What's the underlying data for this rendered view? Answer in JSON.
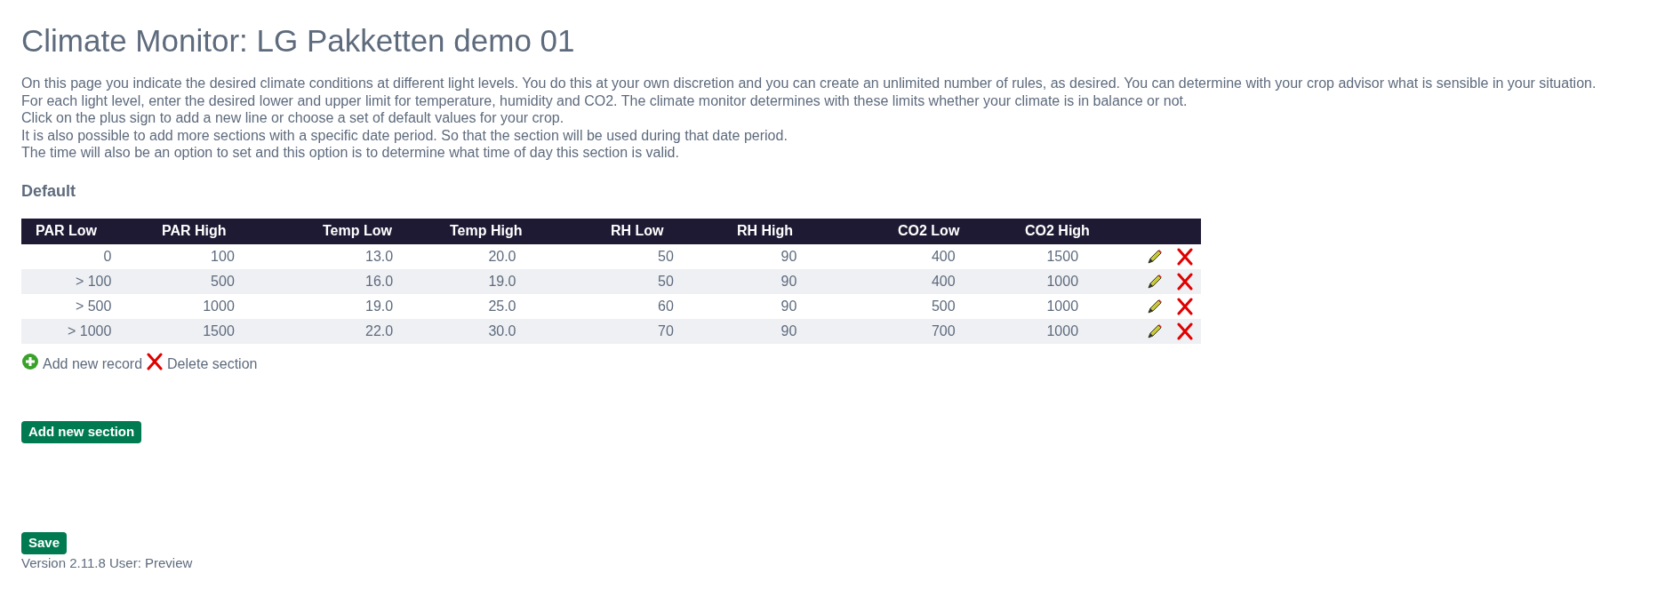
{
  "title": "Climate Monitor: LG Pakketten demo 01",
  "intro": [
    "On this page you indicate the desired climate conditions at different light levels. You do this at your own discretion and you can create an unlimited number of rules, as desired. You can determine with your crop advisor what is sensible in your situation.",
    "For each light level, enter the desired lower and upper limit for temperature, humidity and CO2. The climate monitor determines with these limits whether your climate is in balance or not.",
    "Click on the plus sign to add a new line or choose a set of default values for your crop.",
    "It is also possible to add more sections with a specific date period. So that the section will be used during that date period.",
    "The time will also be an option to set and this option is to determine what time of day this section is valid."
  ],
  "section": {
    "title": "Default",
    "columns": [
      "PAR Low",
      "PAR High",
      "Temp Low",
      "Temp High",
      "RH Low",
      "RH High",
      "CO2 Low",
      "CO2 High"
    ],
    "rows": [
      [
        "0",
        "100",
        "13.0",
        "20.0",
        "50",
        "90",
        "400",
        "1500"
      ],
      [
        "> 100",
        "500",
        "16.0",
        "19.0",
        "50",
        "90",
        "400",
        "1000"
      ],
      [
        "> 500",
        "1000",
        "19.0",
        "25.0",
        "60",
        "90",
        "500",
        "1000"
      ],
      [
        "> 1000",
        "1500",
        "22.0",
        "30.0",
        "70",
        "90",
        "700",
        "1000"
      ]
    ],
    "add_record": "Add new record",
    "delete_section": "Delete section"
  },
  "add_section": "Add new section",
  "save": "Save",
  "footer": "Version 2.11.8 User: Preview"
}
